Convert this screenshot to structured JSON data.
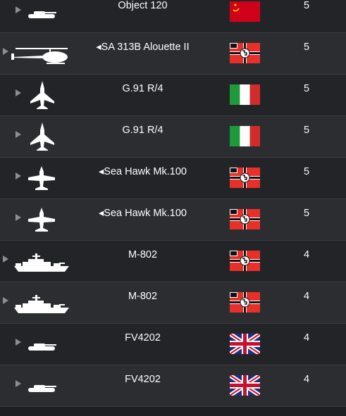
{
  "rows": [
    {
      "name": "Object 120",
      "icon": "tank-icon",
      "flag": "ussr-flag",
      "rank": "5",
      "shade": "dark"
    },
    {
      "name": "◂SA 313B Alouette II",
      "icon": "helicopter-icon",
      "flag": "germany-war-ensign-flag",
      "rank": "5",
      "shade": "light"
    },
    {
      "name": "G.91 R/4",
      "icon": "jet-aircraft-icon",
      "flag": "italy-flag",
      "rank": "5",
      "shade": "dark"
    },
    {
      "name": "G.91 R/4",
      "icon": "jet-aircraft-icon",
      "flag": "italy-flag",
      "rank": "5",
      "shade": "light"
    },
    {
      "name": "◂Sea Hawk Mk.100",
      "icon": "straight-wing-jet-icon",
      "flag": "germany-war-ensign-flag",
      "rank": "5",
      "shade": "dark"
    },
    {
      "name": "◂Sea Hawk Mk.100",
      "icon": "straight-wing-jet-icon",
      "flag": "germany-war-ensign-flag",
      "rank": "5",
      "shade": "light"
    },
    {
      "name": "M-802",
      "icon": "ship-icon",
      "flag": "germany-war-ensign-flag",
      "rank": "4",
      "shade": "dark"
    },
    {
      "name": "M-802",
      "icon": "ship-icon",
      "flag": "germany-war-ensign-flag",
      "rank": "4",
      "shade": "light"
    },
    {
      "name": "FV4202",
      "icon": "tank-icon",
      "flag": "uk-flag",
      "rank": "4",
      "shade": "dark"
    },
    {
      "name": "FV4202",
      "icon": "tank-icon",
      "flag": "uk-flag",
      "rank": "4",
      "shade": "light"
    }
  ],
  "colors": {
    "row_dark": "#232428",
    "row_light": "#2b2d31",
    "text": "#ffffff"
  }
}
